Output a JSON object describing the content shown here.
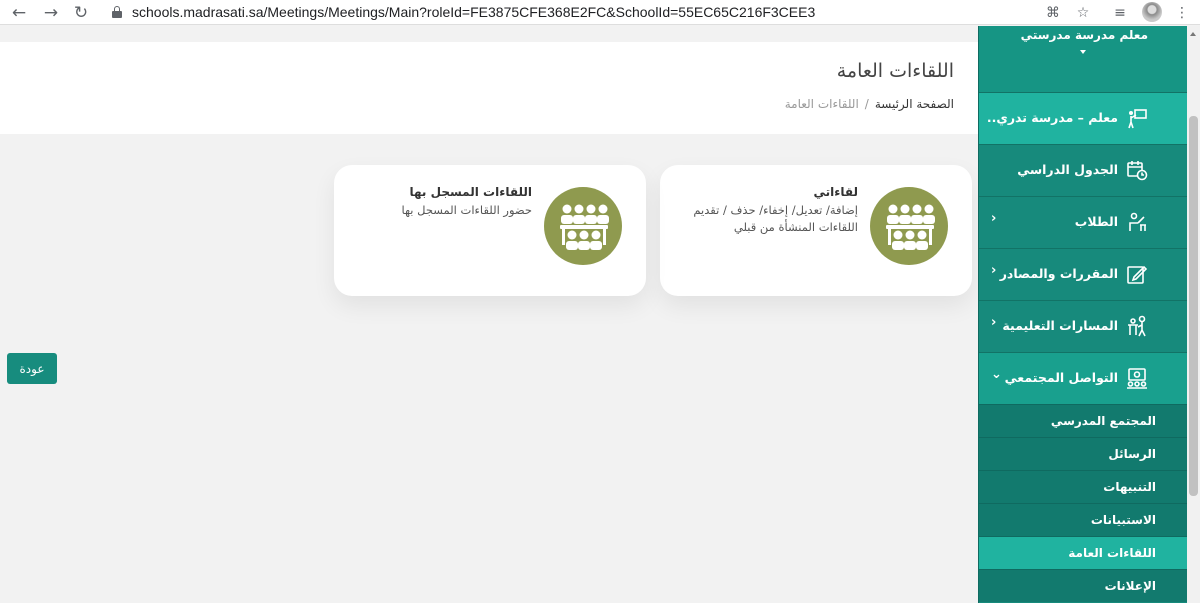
{
  "browser": {
    "url": "schools.madrasati.sa/Meetings/Meetings/Main?roleId=FE3875CFE368E2FC&SchoolId=55EC65C216F3CEE3",
    "back_icon": "←",
    "forward_icon": "→",
    "reload_icon": "↻",
    "star_icon": "☆",
    "translate_icon": "⌘",
    "menu_icon": "⋮",
    "playlist_icon": "≡"
  },
  "header": {
    "title": "اللقاءات العامة",
    "breadcrumb": {
      "home": "الصفحة الرئيسة",
      "separator": "/",
      "current": "اللقاءات العامة"
    }
  },
  "cards": [
    {
      "title": "لقاءاتي",
      "description": "إضافة/ تعديل/ إخفاء/ حذف / تقديم اللقاءات المنشأة من قبلي"
    },
    {
      "title": "اللقاءات المسجل بها",
      "description": "حضور اللقاءات المسجل بها"
    }
  ],
  "back_button": "عودة",
  "sidebar": {
    "top_label": "معلم مدرسة مدرستي",
    "items": [
      {
        "label": "معلم – مدرسة تدري..",
        "chevron": ""
      },
      {
        "label": "الجدول الدراسي",
        "chevron": ""
      },
      {
        "label": "الطلاب",
        "chevron": "›"
      },
      {
        "label": "المقررات والمصادر",
        "chevron": "›"
      },
      {
        "label": "المسارات التعليمية",
        "chevron": "›"
      },
      {
        "label": "التواصل المجتمعي",
        "chevron": "⌄"
      }
    ],
    "subitems": [
      {
        "label": "المجتمع المدرسي"
      },
      {
        "label": "الرسائل"
      },
      {
        "label": "التنبيهات"
      },
      {
        "label": "الاستبيانات"
      },
      {
        "label": "اللقاءات العامة"
      },
      {
        "label": "الإعلانات"
      }
    ]
  },
  "colors": {
    "sidebar": "#178a7c",
    "active": "#20b3a0",
    "icon_circle": "#8f9a4f",
    "button": "#178c7e"
  }
}
